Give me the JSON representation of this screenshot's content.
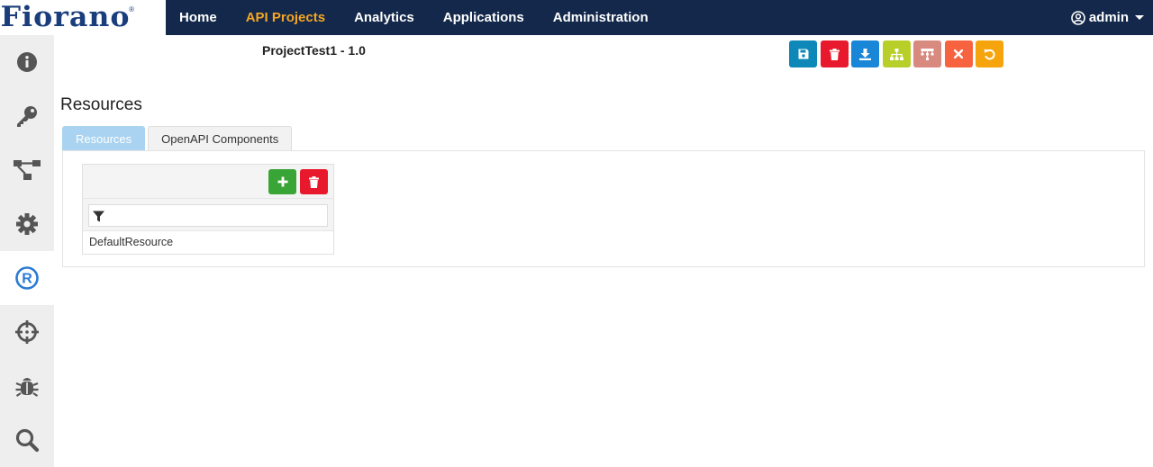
{
  "brand": {
    "logo": "Fiorano",
    "reg": "®"
  },
  "nav": {
    "items": [
      {
        "label": "Home",
        "active": false
      },
      {
        "label": "API Projects",
        "active": true
      },
      {
        "label": "Analytics",
        "active": false
      },
      {
        "label": "Applications",
        "active": false
      },
      {
        "label": "Administration",
        "active": false
      }
    ],
    "user": "admin"
  },
  "sidebar": {
    "items": [
      {
        "icon": "info-icon"
      },
      {
        "icon": "key-icon"
      },
      {
        "icon": "flow-icon"
      },
      {
        "icon": "gear-icon"
      },
      {
        "icon": "registered-icon",
        "active": true
      },
      {
        "icon": "crosshair-icon"
      },
      {
        "icon": "bug-icon"
      },
      {
        "icon": "search-icon"
      }
    ]
  },
  "project": {
    "title": "ProjectTest1 - 1.0"
  },
  "toolbar": {
    "buttons": [
      {
        "icon": "save-icon",
        "color": "#0d88b9"
      },
      {
        "icon": "trash-icon",
        "color": "#e8192c"
      },
      {
        "icon": "download-icon",
        "color": "#1a86d8"
      },
      {
        "icon": "sitemap-icon",
        "color": "#b8cf2a"
      },
      {
        "icon": "hierarchy-icon",
        "color": "#d98a7f"
      },
      {
        "icon": "close-icon",
        "color": "#f7633f"
      },
      {
        "icon": "undo-icon",
        "color": "#f5a40c"
      }
    ]
  },
  "resources": {
    "title": "Resources",
    "tabs": [
      {
        "label": "Resources",
        "active": true
      },
      {
        "label": "OpenAPI Components",
        "active": false
      }
    ],
    "filter_value": "",
    "list": [
      "DefaultResource"
    ]
  },
  "colors": {
    "navbar": "#13284a",
    "nav_active": "#f5a623",
    "tab_active": "#a9d3f0",
    "add": "#3aa537",
    "delete": "#e8192c"
  }
}
